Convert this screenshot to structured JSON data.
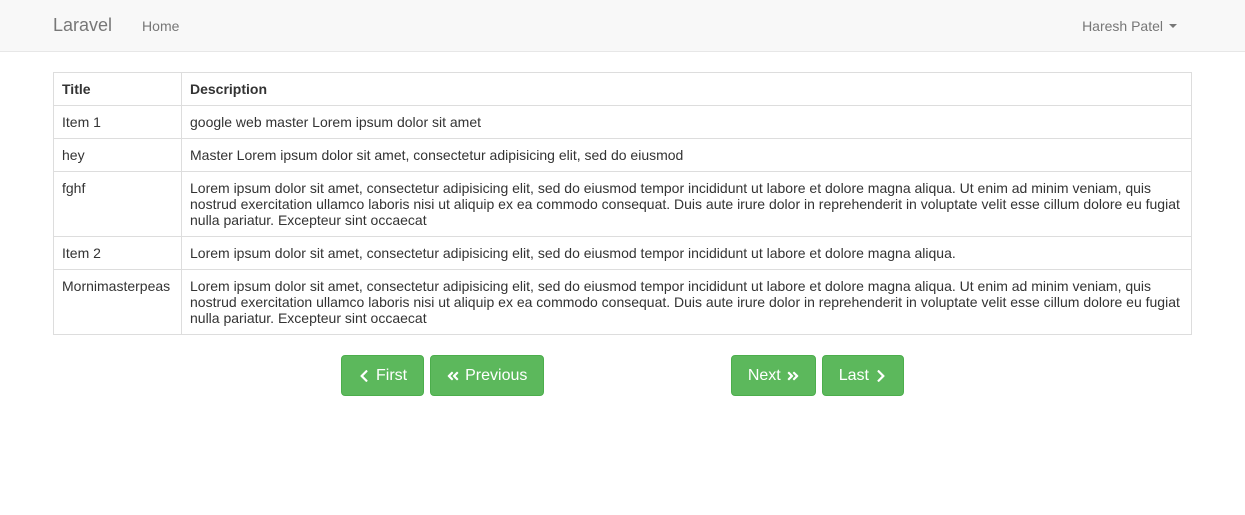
{
  "navbar": {
    "brand": "Laravel",
    "home_label": "Home",
    "username": "Haresh Patel"
  },
  "table": {
    "headers": {
      "title": "Title",
      "description": "Description"
    },
    "rows": [
      {
        "title": "Item 1",
        "description": "google web master Lorem ipsum dolor sit amet"
      },
      {
        "title": "hey",
        "description": "Master Lorem ipsum dolor sit amet, consectetur adipisicing elit, sed do eiusmod"
      },
      {
        "title": "fghf",
        "description": "Lorem ipsum dolor sit amet, consectetur adipisicing elit, sed do eiusmod tempor incididunt ut labore et dolore magna aliqua. Ut enim ad minim veniam, quis nostrud exercitation ullamco laboris nisi ut aliquip ex ea commodo consequat. Duis aute irure dolor in reprehenderit in voluptate velit esse cillum dolore eu fugiat nulla pariatur. Excepteur sint occaecat"
      },
      {
        "title": "Item 2",
        "description": "Lorem ipsum dolor sit amet, consectetur adipisicing elit, sed do eiusmod tempor incididunt ut labore et dolore magna aliqua."
      },
      {
        "title": "Mornimasterpeas",
        "description": "Lorem ipsum dolor sit amet, consectetur adipisicing elit, sed do eiusmod tempor incididunt ut labore et dolore magna aliqua. Ut enim ad minim veniam, quis nostrud exercitation ullamco laboris nisi ut aliquip ex ea commodo consequat. Duis aute irure dolor in reprehenderit in voluptate velit esse cillum dolore eu fugiat nulla pariatur. Excepteur sint occaecat"
      }
    ]
  },
  "pagination": {
    "first_label": "First",
    "previous_label": "Previous",
    "next_label": "Next",
    "last_label": "Last"
  }
}
